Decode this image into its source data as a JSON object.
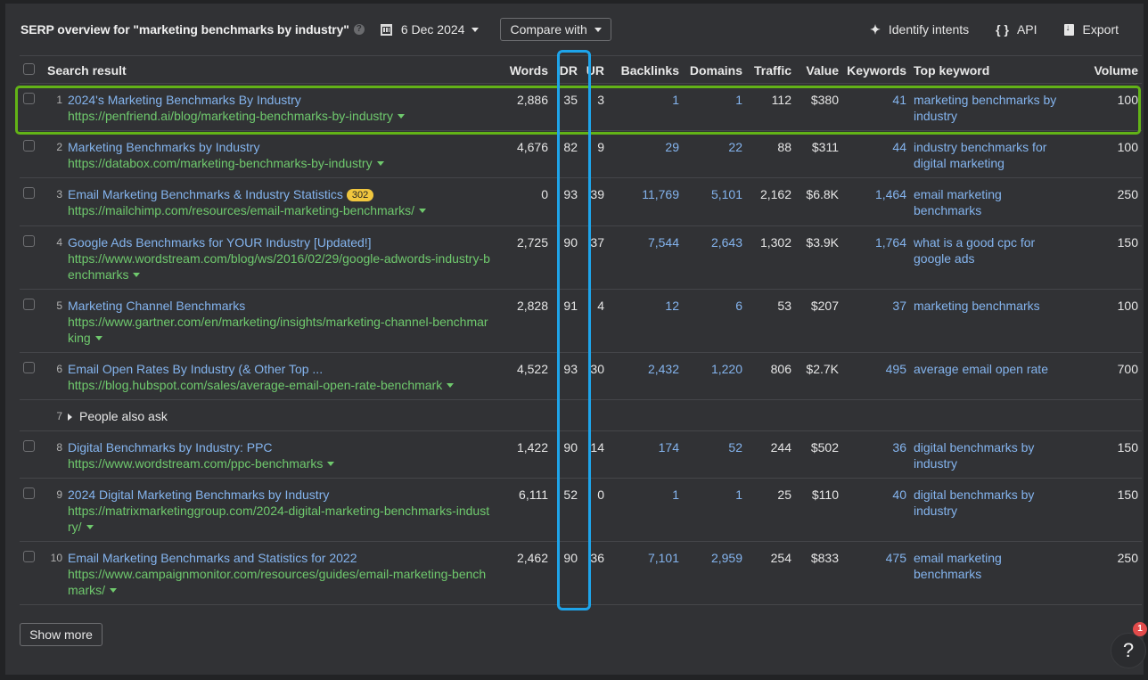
{
  "header": {
    "title": "SERP overview for \"marketing benchmarks by industry\"",
    "help_icon": "question-circle-icon",
    "date": "6 Dec 2024",
    "date_icon": "calendar-icon",
    "compare_label": "Compare with",
    "identify_intents_label": "Identify intents",
    "identify_intents_icon": "sparkle-icon",
    "api_label": "API",
    "api_icon": "braces-icon",
    "export_label": "Export",
    "export_icon": "download-file-icon"
  },
  "columns": {
    "search_result": "Search result",
    "words": "Words",
    "dr": "DR",
    "ur": "UR",
    "backlinks": "Backlinks",
    "domains": "Domains",
    "traffic": "Traffic",
    "value": "Value",
    "keywords": "Keywords",
    "top_keyword": "Top keyword",
    "volume": "Volume"
  },
  "rows": [
    {
      "pos": "1",
      "title": "2024's Marketing Benchmarks By Industry",
      "url": "https://penfriend.ai/blog/marketing-benchmarks-by-industry",
      "words": "2,886",
      "dr": "35",
      "ur": "3",
      "backlinks": "1",
      "domains": "1",
      "traffic": "112",
      "value": "$380",
      "keywords": "41",
      "top_keyword": "marketing benchmarks by industry",
      "volume": "100"
    },
    {
      "pos": "2",
      "title": "Marketing Benchmarks by Industry",
      "url": "https://databox.com/marketing-benchmarks-by-industry",
      "words": "4,676",
      "dr": "82",
      "ur": "9",
      "backlinks": "29",
      "domains": "22",
      "traffic": "88",
      "value": "$311",
      "keywords": "44",
      "top_keyword": "industry benchmarks for digital marketing",
      "volume": "100"
    },
    {
      "pos": "3",
      "title": "Email Marketing Benchmarks & Industry Statistics",
      "badge": "302",
      "url": "https://mailchimp.com/resources/email-marketing-benchmarks/",
      "words": "0",
      "dr": "93",
      "ur": "39",
      "backlinks": "11,769",
      "domains": "5,101",
      "traffic": "2,162",
      "value": "$6.8K",
      "keywords": "1,464",
      "top_keyword": "email marketing benchmarks",
      "volume": "250"
    },
    {
      "pos": "4",
      "title": "Google Ads Benchmarks for YOUR Industry [Updated!]",
      "url": "https://www.wordstream.com/blog/ws/2016/02/29/google-adwords-industry-benchmarks",
      "words": "2,725",
      "dr": "90",
      "ur": "37",
      "backlinks": "7,544",
      "domains": "2,643",
      "traffic": "1,302",
      "value": "$3.9K",
      "keywords": "1,764",
      "top_keyword": "what is a good cpc for google ads",
      "volume": "150"
    },
    {
      "pos": "5",
      "title": "Marketing Channel Benchmarks",
      "url": "https://www.gartner.com/en/marketing/insights/marketing-channel-benchmarking",
      "words": "2,828",
      "dr": "91",
      "ur": "4",
      "backlinks": "12",
      "domains": "6",
      "traffic": "53",
      "value": "$207",
      "keywords": "37",
      "top_keyword": "marketing benchmarks",
      "volume": "100"
    },
    {
      "pos": "6",
      "title": "Email Open Rates By Industry (& Other Top ...",
      "url": "https://blog.hubspot.com/sales/average-email-open-rate-benchmark",
      "words": "4,522",
      "dr": "93",
      "ur": "30",
      "backlinks": "2,432",
      "domains": "1,220",
      "traffic": "806",
      "value": "$2.7K",
      "keywords": "495",
      "top_keyword": "average email open rate",
      "volume": "700"
    },
    {
      "pos": "8",
      "title": "Digital Benchmarks by Industry: PPC",
      "url": "https://www.wordstream.com/ppc-benchmarks",
      "words": "1,422",
      "dr": "90",
      "ur": "14",
      "backlinks": "174",
      "domains": "52",
      "traffic": "244",
      "value": "$502",
      "keywords": "36",
      "top_keyword": "digital benchmarks by industry",
      "volume": "150"
    },
    {
      "pos": "9",
      "title": "2024 Digital Marketing Benchmarks by Industry",
      "url": "https://matrixmarketinggroup.com/2024-digital-marketing-benchmarks-industry/",
      "words": "6,111",
      "dr": "52",
      "ur": "0",
      "backlinks": "1",
      "domains": "1",
      "traffic": "25",
      "value": "$110",
      "keywords": "40",
      "top_keyword": "digital benchmarks by industry",
      "volume": "150"
    },
    {
      "pos": "10",
      "title": "Email Marketing Benchmarks and Statistics for 2022",
      "url": "https://www.campaignmonitor.com/resources/guides/email-marketing-benchmarks/",
      "words": "2,462",
      "dr": "90",
      "ur": "36",
      "backlinks": "7,101",
      "domains": "2,959",
      "traffic": "254",
      "value": "$833",
      "keywords": "475",
      "top_keyword": "email marketing benchmarks",
      "volume": "250"
    }
  ],
  "people_also_ask": {
    "pos": "7",
    "label": "People also ask"
  },
  "footer": {
    "show_more_label": "Show more",
    "help_label": "?",
    "notification_count": "1"
  },
  "highlights": {
    "row_highlight_color": "#62b317",
    "column_highlight_color": "#1ea4ea"
  }
}
